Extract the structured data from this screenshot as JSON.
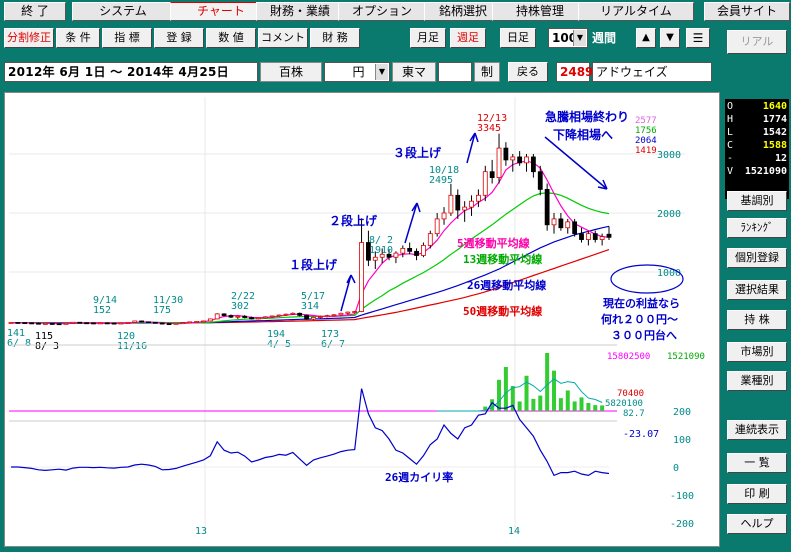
{
  "menu": [
    "終 了",
    "システム",
    "チャート",
    "財務・業績",
    "オプション",
    "銘柄選択",
    "持株管理",
    "リアルタイム",
    "会員サイト"
  ],
  "menu_active_index": 2,
  "toolbar": {
    "row1_left": [
      "分割修正",
      "条 件",
      "指 標",
      "登 録",
      "数 値",
      "コメント",
      "財 務"
    ],
    "period_buttons": [
      "月足",
      "週足",
      "日足"
    ],
    "period_active_index": 1,
    "count_value": "100",
    "count_suffix": "週間",
    "up_arrow": "▲",
    "down_arrow": "▼",
    "list_icon_glyph": "☰",
    "real_button": "リアル",
    "date_range": "2012年 6月 1日 ～ 2014年 4月25日",
    "unit": "百株",
    "currency": "円",
    "market": "東マ",
    "system_field": "",
    "system_label": "制",
    "back_button": "戻る",
    "code": "2489",
    "company": "アドウェイズ"
  },
  "ohlc_panel": [
    {
      "k": "O",
      "v": "1640"
    },
    {
      "k": "H",
      "v": "1774"
    },
    {
      "k": "L",
      "v": "1542"
    },
    {
      "k": "C",
      "v": "1588"
    },
    {
      "k": "-",
      "v": "12"
    },
    {
      "k": "V",
      "v": "1521090"
    }
  ],
  "sidebar_buttons": [
    "基調別",
    "ﾗﾝｷﾝｸﾞ",
    "個別登録",
    "選択結果",
    "持 株",
    "市場別",
    "業種別",
    "連続表示",
    "一 覧",
    "印 刷",
    "ヘルプ"
  ],
  "chart_data": {
    "type": "candlestick",
    "y_axis_labels": [
      "3000",
      "2000",
      "1000"
    ],
    "y_axis_values": [
      3000,
      2000,
      1000
    ],
    "x_axis_labels": [
      "13",
      "14"
    ],
    "price_lines_labels": [
      "2577",
      "1756",
      "2064",
      "1419"
    ],
    "candles": [
      {
        "o": 140,
        "h": 150,
        "l": 130,
        "c": 145
      },
      {
        "o": 145,
        "h": 152,
        "l": 138,
        "c": 142
      },
      {
        "o": 142,
        "h": 148,
        "l": 135,
        "c": 138
      },
      {
        "o": 138,
        "h": 145,
        "l": 128,
        "c": 132
      },
      {
        "o": 132,
        "h": 140,
        "l": 118,
        "c": 121
      },
      {
        "o": 121,
        "h": 133,
        "l": 115,
        "c": 128
      },
      {
        "o": 128,
        "h": 135,
        "l": 120,
        "c": 124
      },
      {
        "o": 124,
        "h": 130,
        "l": 116,
        "c": 120
      },
      {
        "o": 120,
        "h": 132,
        "l": 115,
        "c": 130
      },
      {
        "o": 130,
        "h": 152,
        "l": 125,
        "c": 148
      },
      {
        "o": 148,
        "h": 152,
        "l": 138,
        "c": 140
      },
      {
        "o": 140,
        "h": 146,
        "l": 132,
        "c": 137
      },
      {
        "o": 137,
        "h": 145,
        "l": 128,
        "c": 133
      },
      {
        "o": 133,
        "h": 141,
        "l": 125,
        "c": 138
      },
      {
        "o": 138,
        "h": 146,
        "l": 130,
        "c": 134
      },
      {
        "o": 134,
        "h": 141,
        "l": 126,
        "c": 130
      },
      {
        "o": 130,
        "h": 140,
        "l": 122,
        "c": 136
      },
      {
        "o": 136,
        "h": 148,
        "l": 130,
        "c": 145
      },
      {
        "o": 145,
        "h": 175,
        "l": 140,
        "c": 170
      },
      {
        "o": 170,
        "h": 175,
        "l": 150,
        "c": 155
      },
      {
        "o": 155,
        "h": 162,
        "l": 140,
        "c": 146
      },
      {
        "o": 146,
        "h": 152,
        "l": 130,
        "c": 135
      },
      {
        "o": 135,
        "h": 140,
        "l": 120,
        "c": 125
      },
      {
        "o": 125,
        "h": 131,
        "l": 118,
        "c": 122
      },
      {
        "o": 122,
        "h": 135,
        "l": 118,
        "c": 130
      },
      {
        "o": 130,
        "h": 145,
        "l": 125,
        "c": 142
      },
      {
        "o": 142,
        "h": 160,
        "l": 138,
        "c": 155
      },
      {
        "o": 155,
        "h": 168,
        "l": 148,
        "c": 162
      },
      {
        "o": 162,
        "h": 178,
        "l": 155,
        "c": 170
      },
      {
        "o": 170,
        "h": 210,
        "l": 165,
        "c": 205
      },
      {
        "o": 205,
        "h": 302,
        "l": 200,
        "c": 290
      },
      {
        "o": 290,
        "h": 300,
        "l": 250,
        "c": 262
      },
      {
        "o": 262,
        "h": 280,
        "l": 220,
        "c": 235
      },
      {
        "o": 235,
        "h": 260,
        "l": 205,
        "c": 250
      },
      {
        "o": 250,
        "h": 270,
        "l": 215,
        "c": 228
      },
      {
        "o": 228,
        "h": 246,
        "l": 194,
        "c": 205
      },
      {
        "o": 205,
        "h": 230,
        "l": 198,
        "c": 222
      },
      {
        "o": 222,
        "h": 250,
        "l": 210,
        "c": 240
      },
      {
        "o": 240,
        "h": 262,
        "l": 225,
        "c": 255
      },
      {
        "o": 255,
        "h": 280,
        "l": 240,
        "c": 270
      },
      {
        "o": 270,
        "h": 295,
        "l": 255,
        "c": 285
      },
      {
        "o": 285,
        "h": 314,
        "l": 270,
        "c": 300
      },
      {
        "o": 300,
        "h": 312,
        "l": 250,
        "c": 265
      },
      {
        "o": 265,
        "h": 275,
        "l": 190,
        "c": 200
      },
      {
        "o": 200,
        "h": 240,
        "l": 180,
        "c": 230
      },
      {
        "o": 230,
        "h": 260,
        "l": 210,
        "c": 245
      },
      {
        "o": 245,
        "h": 275,
        "l": 230,
        "c": 260
      },
      {
        "o": 260,
        "h": 285,
        "l": 245,
        "c": 275
      },
      {
        "o": 275,
        "h": 310,
        "l": 260,
        "c": 300
      },
      {
        "o": 300,
        "h": 330,
        "l": 280,
        "c": 320
      },
      {
        "o": 320,
        "h": 340,
        "l": 300,
        "c": 330
      },
      {
        "o": 330,
        "h": 1910,
        "l": 320,
        "c": 1500
      },
      {
        "o": 1500,
        "h": 1700,
        "l": 1100,
        "c": 1200
      },
      {
        "o": 1200,
        "h": 1350,
        "l": 1050,
        "c": 1250
      },
      {
        "o": 1250,
        "h": 1400,
        "l": 1150,
        "c": 1300
      },
      {
        "o": 1300,
        "h": 1380,
        "l": 1200,
        "c": 1250
      },
      {
        "o": 1250,
        "h": 1350,
        "l": 1150,
        "c": 1320
      },
      {
        "o": 1320,
        "h": 1450,
        "l": 1250,
        "c": 1400
      },
      {
        "o": 1400,
        "h": 1500,
        "l": 1300,
        "c": 1350
      },
      {
        "o": 1350,
        "h": 1400,
        "l": 1200,
        "c": 1280
      },
      {
        "o": 1280,
        "h": 1500,
        "l": 1250,
        "c": 1450
      },
      {
        "o": 1450,
        "h": 1700,
        "l": 1400,
        "c": 1650
      },
      {
        "o": 1650,
        "h": 2000,
        "l": 1600,
        "c": 1900
      },
      {
        "o": 1900,
        "h": 2100,
        "l": 1800,
        "c": 2000
      },
      {
        "o": 2000,
        "h": 2495,
        "l": 1950,
        "c": 2300
      },
      {
        "o": 2300,
        "h": 2400,
        "l": 1900,
        "c": 2050
      },
      {
        "o": 2050,
        "h": 2200,
        "l": 1850,
        "c": 2100
      },
      {
        "o": 2100,
        "h": 2300,
        "l": 1950,
        "c": 2200
      },
      {
        "o": 2200,
        "h": 2400,
        "l": 2100,
        "c": 2300
      },
      {
        "o": 2300,
        "h": 2800,
        "l": 2200,
        "c": 2700
      },
      {
        "o": 2700,
        "h": 2900,
        "l": 2500,
        "c": 2600
      },
      {
        "o": 2600,
        "h": 3345,
        "l": 2500,
        "c": 3100
      },
      {
        "o": 3100,
        "h": 3200,
        "l": 2800,
        "c": 2900
      },
      {
        "o": 2900,
        "h": 3000,
        "l": 2700,
        "c": 2950
      },
      {
        "o": 2950,
        "h": 3050,
        "l": 2800,
        "c": 2850
      },
      {
        "o": 2850,
        "h": 3000,
        "l": 2700,
        "c": 2950
      },
      {
        "o": 2950,
        "h": 3000,
        "l": 2600,
        "c": 2700
      },
      {
        "o": 2700,
        "h": 2800,
        "l": 2300,
        "c": 2400
      },
      {
        "o": 2400,
        "h": 2500,
        "l": 1700,
        "c": 1800
      },
      {
        "o": 1800,
        "h": 2000,
        "l": 1650,
        "c": 1900
      },
      {
        "o": 1900,
        "h": 2000,
        "l": 1700,
        "c": 1750
      },
      {
        "o": 1750,
        "h": 1900,
        "l": 1650,
        "c": 1850
      },
      {
        "o": 1850,
        "h": 1900,
        "l": 1600,
        "c": 1650
      },
      {
        "o": 1650,
        "h": 1750,
        "l": 1500,
        "c": 1550
      },
      {
        "o": 1550,
        "h": 1700,
        "l": 1450,
        "c": 1650
      },
      {
        "o": 1650,
        "h": 1700,
        "l": 1500,
        "c": 1550
      },
      {
        "o": 1550,
        "h": 1650,
        "l": 1450,
        "c": 1600
      },
      {
        "o": 1640,
        "h": 1774,
        "l": 1542,
        "c": 1588
      }
    ],
    "ma_5": [
      140,
      142,
      141,
      138,
      132,
      130,
      128,
      125,
      125,
      130,
      135,
      139,
      140,
      137,
      136,
      134,
      134,
      136,
      145,
      152,
      152,
      147,
      138,
      130,
      126,
      127,
      135,
      146,
      158,
      175,
      215,
      245,
      258,
      262,
      245,
      230,
      225,
      228,
      238,
      252,
      268,
      282,
      285,
      276,
      262,
      250,
      248,
      252,
      260,
      272,
      290,
      630,
      850,
      1000,
      1150,
      1250,
      1280,
      1300,
      1310,
      1290,
      1330,
      1420,
      1540,
      1700,
      1830,
      1940,
      2040,
      2090,
      2180,
      2250,
      2350,
      2520,
      2730,
      2820,
      2860,
      2880,
      2850,
      2760,
      2560,
      2330,
      2120,
      1950,
      1820,
      1760,
      1700,
      1640,
      1600,
      1590
    ],
    "ma_13": [
      140,
      141,
      141,
      140,
      138,
      136,
      134,
      132,
      130,
      130,
      131,
      132,
      133,
      134,
      134,
      135,
      135,
      136,
      139,
      142,
      144,
      145,
      144,
      142,
      140,
      139,
      139,
      140,
      143,
      148,
      160,
      172,
      183,
      192,
      200,
      206,
      211,
      214,
      219,
      226,
      233,
      238,
      244,
      247,
      247,
      247,
      248,
      250,
      255,
      260,
      265,
      370,
      450,
      530,
      600,
      680,
      740,
      810,
      870,
      930,
      990,
      1060,
      1130,
      1210,
      1300,
      1380,
      1470,
      1560,
      1640,
      1720,
      1800,
      1890,
      1980,
      2060,
      2140,
      2220,
      2290,
      2330,
      2340,
      2330,
      2300,
      2250,
      2190,
      2130,
      2080,
      2040,
      2010,
      1990
    ],
    "ma_26": [
      140,
      140,
      140,
      140,
      139,
      139,
      138,
      137,
      136,
      135,
      135,
      134,
      134,
      134,
      134,
      134,
      134,
      134,
      135,
      136,
      137,
      138,
      138,
      138,
      138,
      138,
      139,
      140,
      141,
      142,
      147,
      152,
      157,
      162,
      166,
      170,
      174,
      177,
      181,
      185,
      190,
      194,
      198,
      201,
      204,
      207,
      211,
      215,
      219,
      224,
      228,
      270,
      305,
      340,
      375,
      410,
      445,
      480,
      515,
      550,
      585,
      620,
      655,
      690,
      730,
      770,
      815,
      860,
      905,
      950,
      1000,
      1050,
      1110,
      1170,
      1230,
      1290,
      1350,
      1410,
      1460,
      1510,
      1550,
      1590,
      1630,
      1660,
      1690,
      1720,
      1750,
      1775
    ],
    "ma_50": [
      140,
      140,
      140,
      140,
      140,
      140,
      140,
      139,
      139,
      139,
      139,
      139,
      139,
      138,
      138,
      138,
      138,
      138,
      138,
      138,
      139,
      139,
      139,
      139,
      139,
      139,
      139,
      140,
      140,
      141,
      142,
      144,
      146,
      148,
      150,
      152,
      155,
      157,
      160,
      162,
      165,
      167,
      170,
      172,
      175,
      178,
      181,
      184,
      187,
      190,
      193,
      215,
      235,
      255,
      275,
      295,
      315,
      340,
      365,
      390,
      415,
      440,
      465,
      490,
      515,
      540,
      570,
      600,
      630,
      665,
      700,
      740,
      780,
      820,
      860,
      900,
      940,
      980,
      1020,
      1060,
      1100,
      1140,
      1180,
      1220,
      1260,
      1300,
      1340,
      1380
    ],
    "price_annotations": [
      {
        "label1": "141",
        "label2": "6/ 8",
        "color": "#008b8b"
      },
      {
        "label1": "115",
        "label2": "8/ 3",
        "color": "#000"
      },
      {
        "label1": "9/14",
        "label2": "152",
        "color": "#008b8b"
      },
      {
        "label1": "120",
        "label2": "11/16",
        "color": "#008b8b"
      },
      {
        "label1": "11/30",
        "label2": "175",
        "color": "#008b8b"
      },
      {
        "label1": "2/22",
        "label2": "302",
        "color": "#008b8b"
      },
      {
        "label1": "194",
        "label2": "4/ 5",
        "color": "#008b8b"
      },
      {
        "label1": "5/17",
        "label2": "314",
        "color": "#008b8b"
      },
      {
        "label1": "173",
        "label2": "6/ 7",
        "color": "#008b8b"
      },
      {
        "label1": "8/ 2",
        "label2": "1910",
        "color": "#008b8b"
      },
      {
        "label1": "10/18",
        "label2": "2495",
        "color": "#008b8b"
      },
      {
        "label1": "12/13",
        "label2": "3345",
        "color": "#e00000"
      }
    ],
    "text_annotations": [
      {
        "text": "急騰相場終わり",
        "color": "#0000cc"
      },
      {
        "text": "下降相場へ",
        "color": "#0000cc"
      },
      {
        "text": "３段上げ",
        "color": "#0000cc"
      },
      {
        "text": "２段上げ",
        "color": "#0000cc"
      },
      {
        "text": "１段上げ",
        "color": "#0000cc"
      },
      {
        "text": "5週移動平均線",
        "color": "#ff00aa"
      },
      {
        "text": "13週移動平均線",
        "color": "#00aa00"
      },
      {
        "text": "26週移動平均線",
        "color": "#0000cc"
      },
      {
        "text": "50週移動平均線",
        "color": "#e00000"
      },
      {
        "text": "現在の利益なら",
        "color": "#0000cc"
      },
      {
        "text": "何れ２００円～",
        "color": "#0000cc"
      },
      {
        "text": "３００円台へ",
        "color": "#0000cc"
      }
    ],
    "volume_labels": [
      "15802500",
      "1521090",
      "70400",
      "5820100",
      "82.7"
    ],
    "volume": [
      0,
      0,
      0,
      0,
      0,
      0,
      0,
      0,
      0,
      0,
      0,
      0,
      0,
      0,
      0,
      0,
      0,
      0,
      0,
      0,
      0,
      0,
      0,
      0,
      0,
      0,
      0,
      0,
      0,
      0,
      0,
      0,
      0,
      0,
      0,
      0,
      0,
      0,
      0,
      0,
      0,
      0,
      0,
      0,
      0,
      0,
      0,
      0,
      0,
      0,
      0,
      0,
      0,
      0,
      0,
      0,
      0,
      0,
      0,
      0,
      0,
      0,
      0,
      0,
      0,
      0,
      0,
      0,
      0,
      1200000,
      3200000,
      8500000,
      12000000,
      6800000,
      2600000,
      9600000,
      3300000,
      4200000,
      15802500,
      11000000,
      3500000,
      5600000,
      2600000,
      3700000,
      2200000,
      1600000,
      1521090
    ],
    "volume_ma_label": "",
    "kairi_label": "26週カイリ率",
    "kairi_current": "-23.07",
    "kairi_axis": [
      "200",
      "100",
      "0",
      "-100",
      "-200"
    ],
    "kairi_axis_values": [
      200,
      100,
      0,
      -100,
      -200
    ],
    "kairi": [
      0,
      0,
      -2,
      -5,
      -10,
      -12,
      -10,
      -8,
      -11,
      -4,
      -1,
      -1,
      -2,
      -1,
      -3,
      -4,
      -1,
      0,
      7,
      10,
      7,
      2,
      -10,
      -9,
      -5,
      3,
      10,
      17,
      25,
      40,
      90,
      60,
      50,
      53,
      39,
      18,
      25,
      34,
      38,
      45,
      42,
      52,
      29,
      6,
      25,
      33,
      39,
      46,
      55,
      60,
      62,
      280,
      190,
      140,
      130,
      100,
      60,
      50,
      30,
      10,
      40,
      80,
      100,
      150,
      120,
      100,
      140,
      150,
      185,
      190,
      230,
      210,
      210,
      220,
      170,
      140,
      110,
      60,
      20,
      -30,
      -20,
      -20,
      -15,
      -25,
      -30,
      -15,
      -20,
      -23.07
    ]
  }
}
